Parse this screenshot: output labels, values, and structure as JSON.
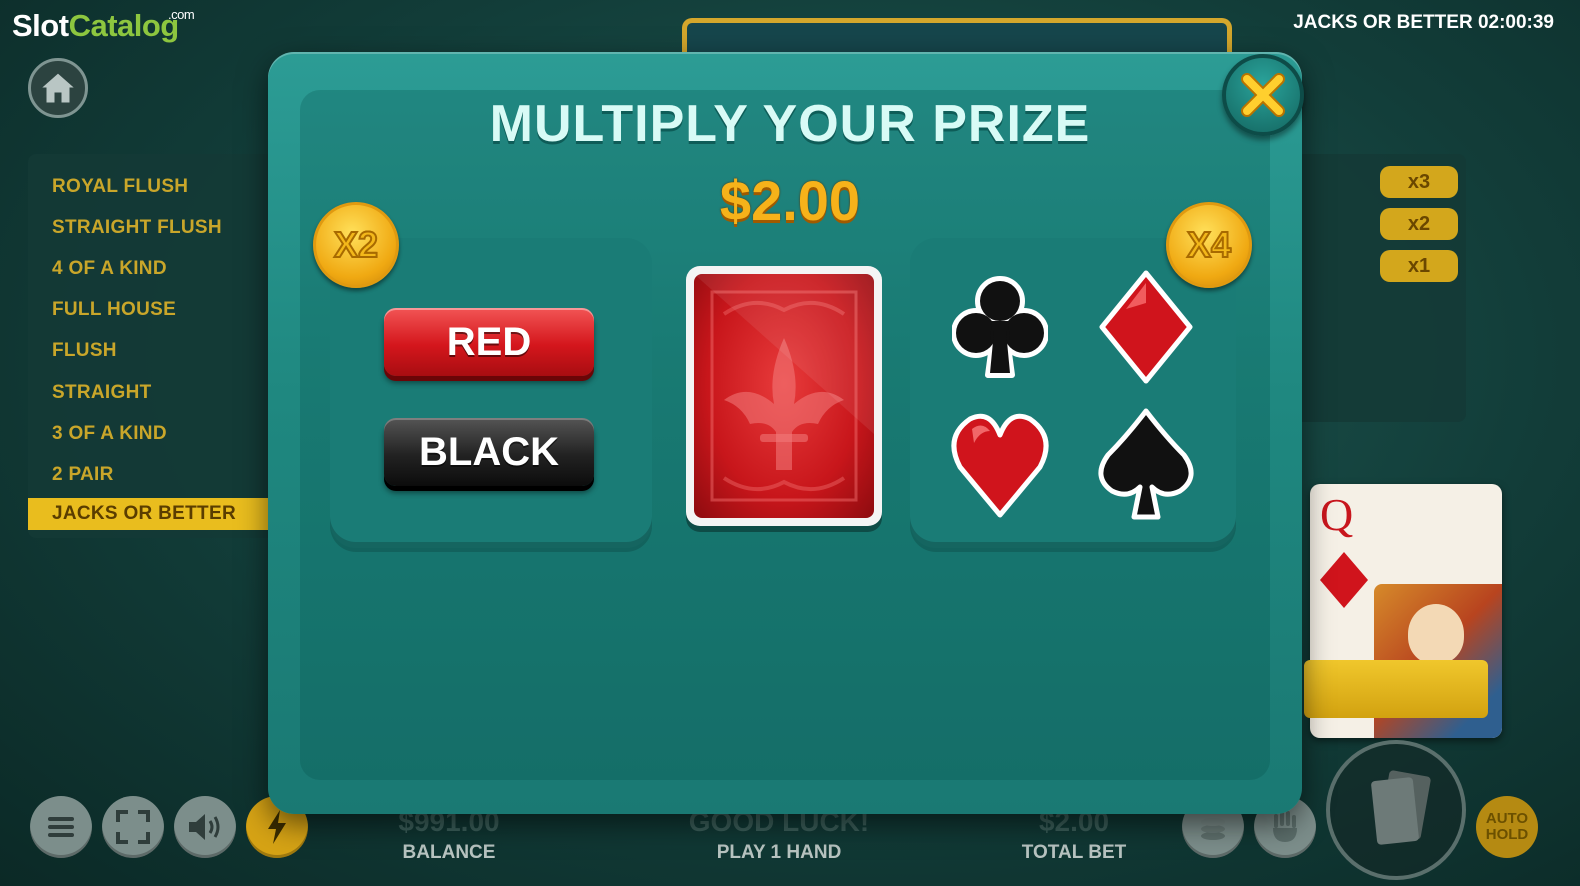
{
  "branding": {
    "logo_part1": "Slot",
    "logo_part2": "Catalog",
    "logo_suffix": ".com"
  },
  "header": {
    "clock_text": "JACKS OR BETTER 02:00:39"
  },
  "paytable": {
    "hands": [
      "ROYAL FLUSH",
      "STRAIGHT FLUSH",
      "4 OF A KIND",
      "FULL HOUSE",
      "FLUSH",
      "STRAIGHT",
      "3 OF A KIND",
      "2 PAIR",
      "JACKS OR BETTER"
    ],
    "active_hand": "JACKS OR BETTER",
    "multipliers": [
      "x3",
      "x2",
      "x1"
    ]
  },
  "dealt_card": {
    "rank": "Q",
    "suit": "diamonds"
  },
  "modal": {
    "title": "MULTIPLY YOUR PRIZE",
    "prize": "$2.00",
    "color_panel_badge": "X2",
    "suit_panel_badge": "X4",
    "red_label": "RED",
    "black_label": "BLACK",
    "suits": [
      "clubs",
      "diamonds",
      "hearts",
      "spades"
    ],
    "close_icon": "close-x-icon"
  },
  "bottom_bar": {
    "balance_value": "$991.00",
    "balance_label": "BALANCE",
    "message": "GOOD LUCK!",
    "message_label": "PLAY 1 HAND",
    "total_bet_value": "$2.00",
    "total_bet_label": "TOTAL BET",
    "auto_hold_label": "AUTO\nHOLD"
  },
  "colors": {
    "modal_teal": "#1f8880",
    "gold": "#f6b21a",
    "red": "#d4161c",
    "paytable_text": "#c9a62a",
    "active_row": "#e9bd1e"
  }
}
